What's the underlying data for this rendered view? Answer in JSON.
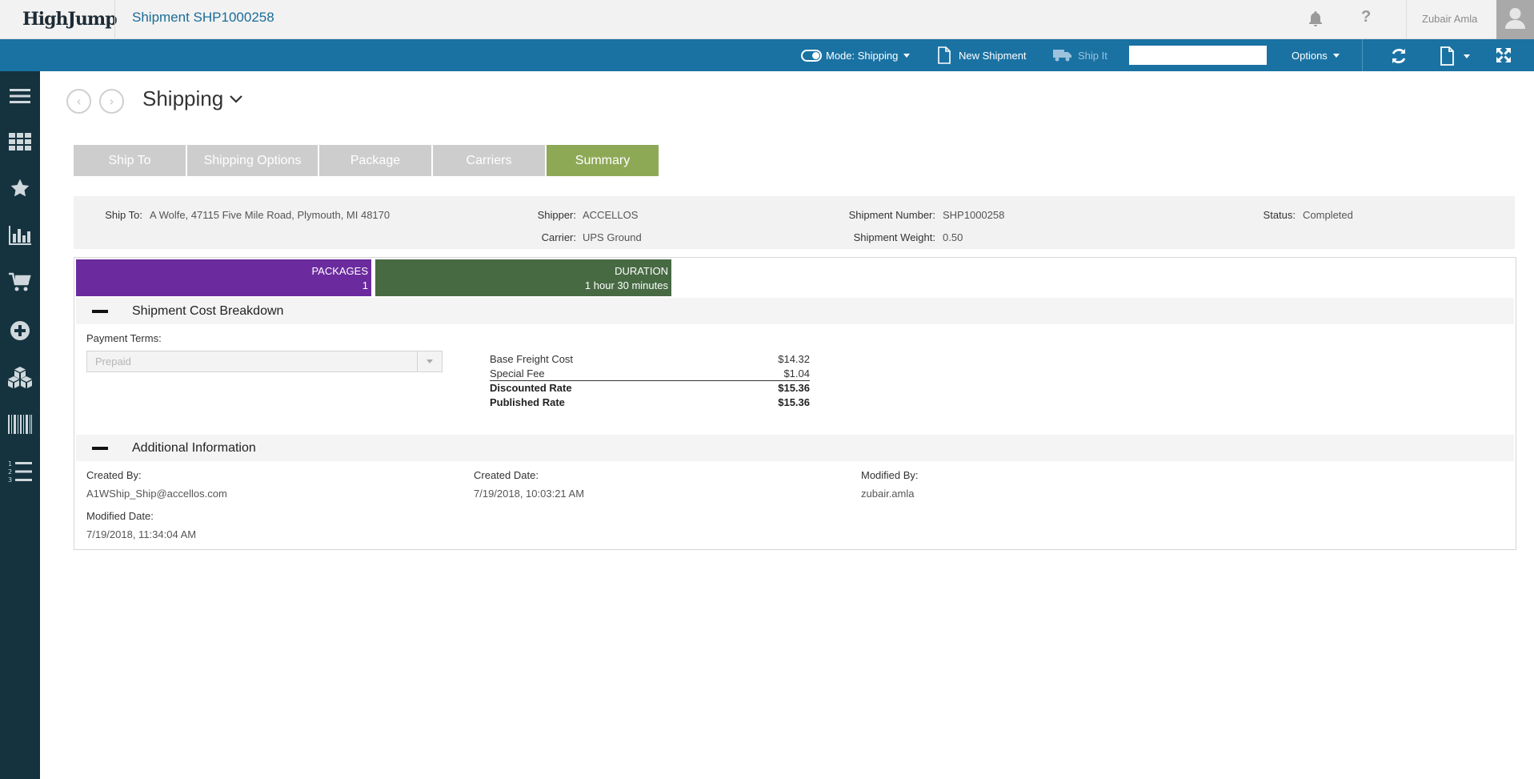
{
  "header": {
    "logo_text": "HighJump",
    "page_heading": "Shipment SHP1000258",
    "help_label": "?",
    "user_name": "Zubair Amla"
  },
  "actionbar": {
    "mode_label": "Mode: Shipping",
    "new_shipment_label": "New Shipment",
    "ship_it_label": "Ship It",
    "search_placeholder": "",
    "options_label": "Options"
  },
  "sidebar": {
    "icons": [
      "menu-icon",
      "grid-icon",
      "star-icon",
      "bar-chart-icon",
      "cart-icon",
      "plus-circle-icon",
      "boxes-icon",
      "barcode-icon",
      "numbered-list-icon"
    ]
  },
  "page": {
    "section_title": "Shipping",
    "back_glyph": "‹",
    "forward_glyph": "›"
  },
  "tabs": [
    {
      "label": "Ship To",
      "active": false
    },
    {
      "label": "Shipping Options",
      "active": false
    },
    {
      "label": "Package",
      "active": false
    },
    {
      "label": "Carriers",
      "active": false
    },
    {
      "label": "Summary",
      "active": true
    }
  ],
  "summary": {
    "ship_to_label": "Ship To:",
    "ship_to_value": "A Wolfe, 47115 Five Mile Road, Plymouth, MI 48170",
    "shipper_label": "Shipper:",
    "shipper_value": "ACCELLOS",
    "carrier_label": "Carrier:",
    "carrier_value": "UPS Ground",
    "shipment_number_label": "Shipment Number:",
    "shipment_number_value": "SHP1000258",
    "shipment_weight_label": "Shipment Weight:",
    "shipment_weight_value": "0.50",
    "status_label": "Status:",
    "status_value": "Completed"
  },
  "tiles": {
    "packages_label": "PACKAGES",
    "packages_value": "1",
    "duration_label": "DURATION",
    "duration_value": "1 hour 30 minutes"
  },
  "cost_breakdown": {
    "title": "Shipment Cost Breakdown",
    "payment_terms_label": "Payment Terms:",
    "payment_terms_value": "Prepaid",
    "rows": [
      {
        "label": "Base Freight Cost",
        "value": "$14.32"
      },
      {
        "label": "Special Fee",
        "value": "$1.04"
      },
      {
        "label": "Discounted Rate",
        "value": "$15.36"
      },
      {
        "label": "Published Rate",
        "value": "$15.36"
      }
    ]
  },
  "additional_info": {
    "title": "Additional Information",
    "created_by_label": "Created By:",
    "created_by_value": "A1WShip_Ship@accellos.com",
    "created_date_label": "Created Date:",
    "created_date_value": "7/19/2018, 10:03:21 AM",
    "modified_by_label": "Modified By:",
    "modified_by_value": "zubair.amla",
    "modified_date_label": "Modified Date:",
    "modified_date_value": "7/19/2018, 11:34:04 AM"
  },
  "colors": {
    "accent_blue": "#1a72a3",
    "sidebar": "#15323f",
    "tab_active": "#8ea956",
    "packages_tile": "#6b2b9e",
    "duration_tile": "#476a43"
  }
}
